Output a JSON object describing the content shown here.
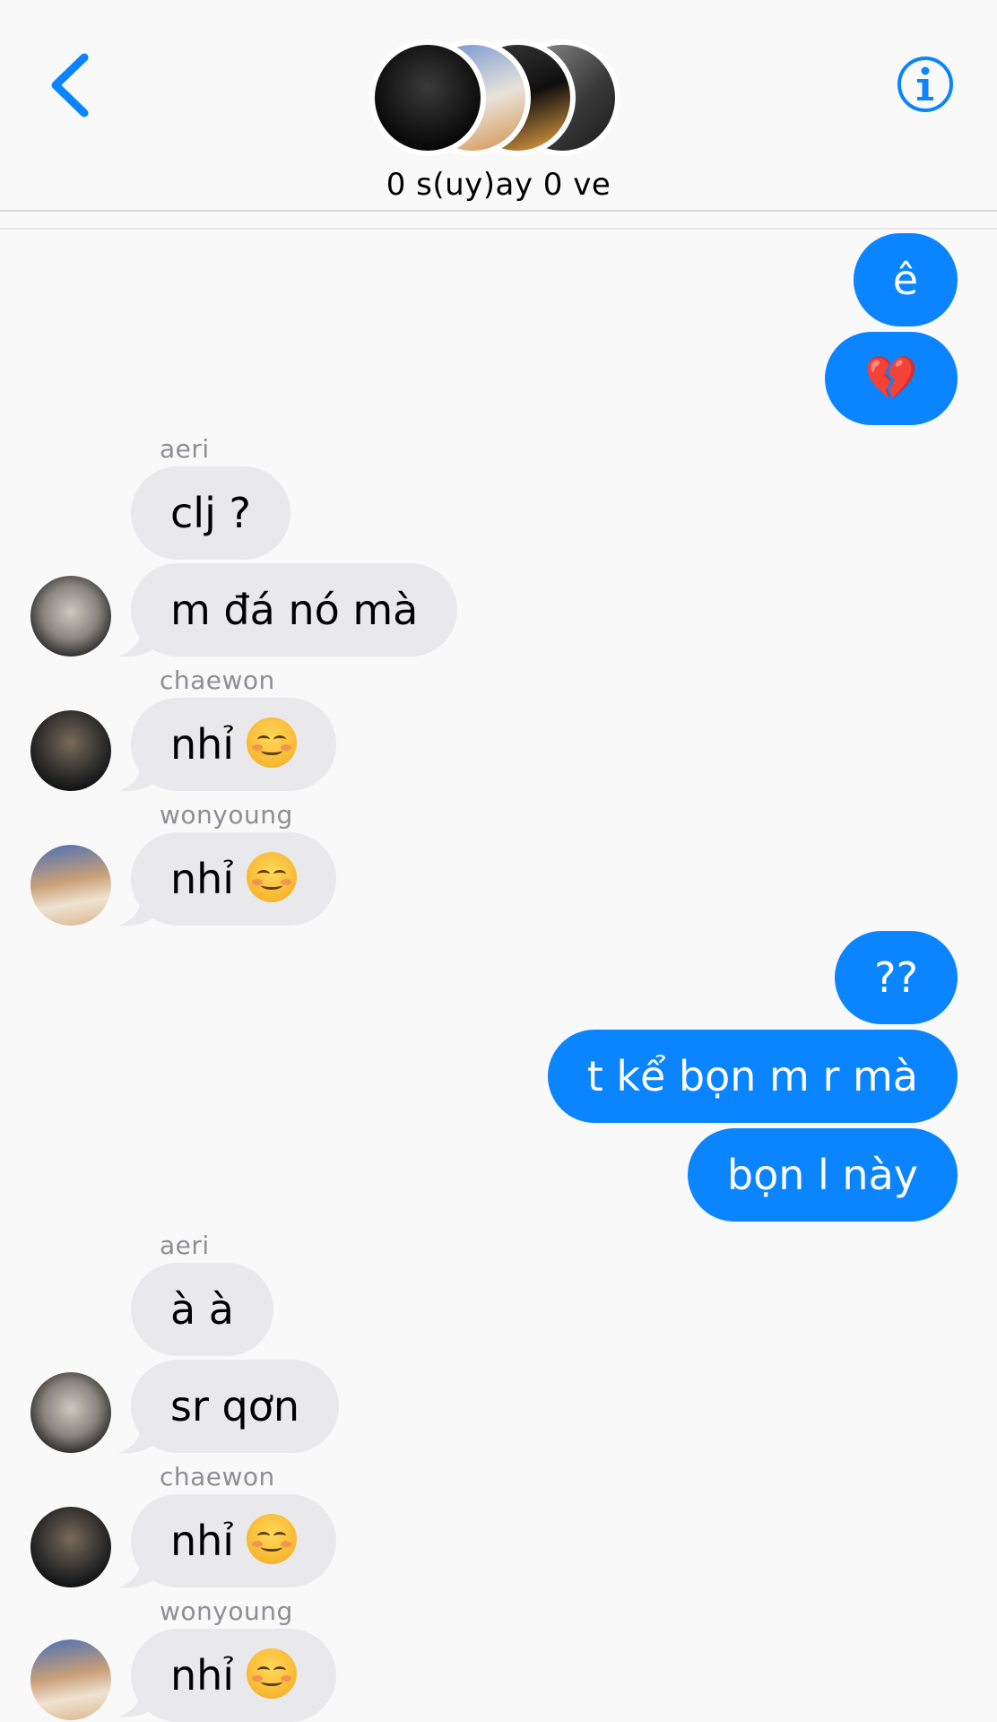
{
  "header": {
    "group_name": "0 s(uy)ay 0 ve",
    "back_icon": "chevron-left-icon",
    "info_icon": "info-icon",
    "accent": "#0a84ff"
  },
  "messages": [
    {
      "type": "out",
      "text": "ê"
    },
    {
      "type": "out",
      "text": "💔"
    },
    {
      "type": "sender",
      "text": "aeri"
    },
    {
      "type": "in",
      "text": "clj ?"
    },
    {
      "type": "in",
      "text": "m đá nó mà"
    },
    {
      "type": "sender",
      "text": "chaewon"
    },
    {
      "type": "in",
      "text": "nhỉ",
      "emoji": "smiling-face"
    },
    {
      "type": "sender",
      "text": "wonyoung"
    },
    {
      "type": "in",
      "text": "nhỉ",
      "emoji": "smiling-face"
    },
    {
      "type": "out",
      "text": "??"
    },
    {
      "type": "out",
      "text": "t kể bọn m r mà"
    },
    {
      "type": "out",
      "text": "bọn l này"
    },
    {
      "type": "sender",
      "text": "aeri"
    },
    {
      "type": "in",
      "text": "à à"
    },
    {
      "type": "in",
      "text": "sr qơn"
    },
    {
      "type": "sender",
      "text": "chaewon"
    },
    {
      "type": "in",
      "text": "nhỉ",
      "emoji": "smiling-face"
    },
    {
      "type": "sender",
      "text": "wonyoung"
    },
    {
      "type": "in",
      "text": "nhỉ",
      "emoji": "smiling-face"
    }
  ],
  "colors": {
    "outgoing_bubble": "#0a84ff",
    "incoming_bubble": "#e9e9eb",
    "sender_label": "#8e8e93"
  }
}
